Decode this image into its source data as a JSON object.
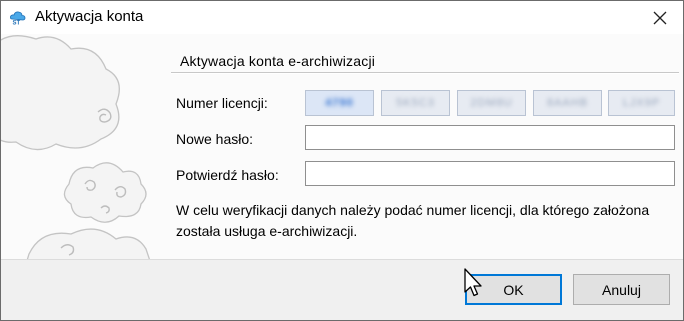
{
  "window": {
    "title": "Aktywacja konta",
    "app_icon": "cloud-archive-icon",
    "close_icon": "close-icon"
  },
  "section": {
    "title": "Aktywacja konta e-archiwizacji"
  },
  "form": {
    "license_label": "Numer licencji:",
    "license_segments": [
      "4790",
      "5K5C3",
      "2DM8U",
      "8AAHB",
      "LJX9P"
    ],
    "new_password_label": "Nowe hasło:",
    "new_password_value": "",
    "confirm_password_label": "Potwierdź hasło:",
    "confirm_password_value": ""
  },
  "info_text": "W celu weryfikacji danych należy podać numer licencji, dla którego założona została usługa e-archiwizacji.",
  "buttons": {
    "ok": "OK",
    "cancel": "Anuluj"
  },
  "colors": {
    "accent": "#0078d7",
    "license_highlight": "#2f6fd0"
  }
}
